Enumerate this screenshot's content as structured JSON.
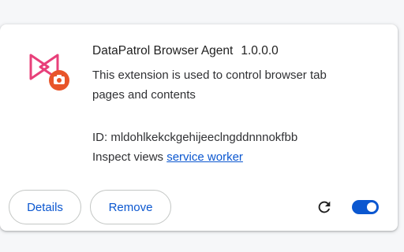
{
  "extension": {
    "name": "DataPatrol Browser Agent",
    "version": "1.0.0.0",
    "description": "This extension is used to control browser tab pages and contents",
    "id_text": "ID: mldohlkekckgehijeeclngddnnnokfbb",
    "inspect_label": "Inspect views",
    "inspect_link": "service worker",
    "enabled": true
  },
  "buttons": {
    "details": "Details",
    "remove": "Remove"
  },
  "icons": {
    "extension": "datapatrol-logo-icon",
    "reload": "reload-icon",
    "toggle": "toggle-switch"
  },
  "colors": {
    "accent": "#0b57d0",
    "logo_pink": "#e8407a",
    "logo_orange": "#e8552a"
  }
}
